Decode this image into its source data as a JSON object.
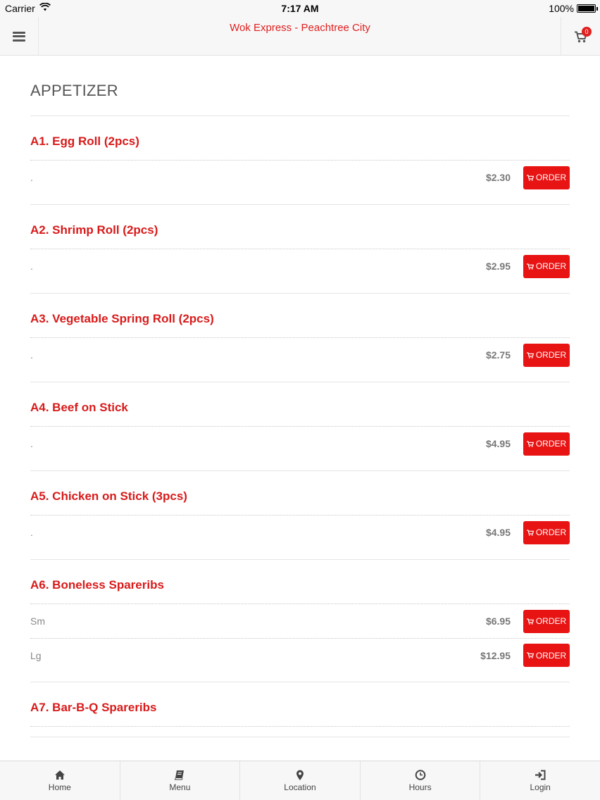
{
  "status_bar": {
    "carrier": "Carrier",
    "time": "7:17 AM",
    "battery": "100%"
  },
  "header": {
    "title": "Wok Express - Peachtree City",
    "cart_count": "0"
  },
  "section": {
    "title": "APPETIZER"
  },
  "order_label": "ORDER",
  "items": [
    {
      "name": "A1. Egg Roll (2pcs)",
      "options": [
        {
          "label": ".",
          "price": "$2.30"
        }
      ]
    },
    {
      "name": "A2. Shrimp Roll (2pcs)",
      "options": [
        {
          "label": ".",
          "price": "$2.95"
        }
      ]
    },
    {
      "name": "A3. Vegetable Spring Roll (2pcs)",
      "options": [
        {
          "label": ".",
          "price": "$2.75"
        }
      ]
    },
    {
      "name": "A4. Beef on Stick",
      "options": [
        {
          "label": ".",
          "price": "$4.95"
        }
      ]
    },
    {
      "name": "A5. Chicken on Stick (3pcs)",
      "options": [
        {
          "label": ".",
          "price": "$4.95"
        }
      ]
    },
    {
      "name": "A6. Boneless Spareribs",
      "options": [
        {
          "label": "Sm",
          "price": "$6.95"
        },
        {
          "label": "Lg",
          "price": "$12.95"
        }
      ]
    },
    {
      "name": "A7. Bar-B-Q Spareribs",
      "options": []
    }
  ],
  "nav": [
    {
      "label": "Home",
      "icon": "home-icon"
    },
    {
      "label": "Menu",
      "icon": "book-icon"
    },
    {
      "label": "Location",
      "icon": "map-pin-icon"
    },
    {
      "label": "Hours",
      "icon": "clock-icon"
    },
    {
      "label": "Login",
      "icon": "login-icon"
    }
  ],
  "colors": {
    "accent": "#e81313",
    "item_title": "#d91a1a"
  }
}
